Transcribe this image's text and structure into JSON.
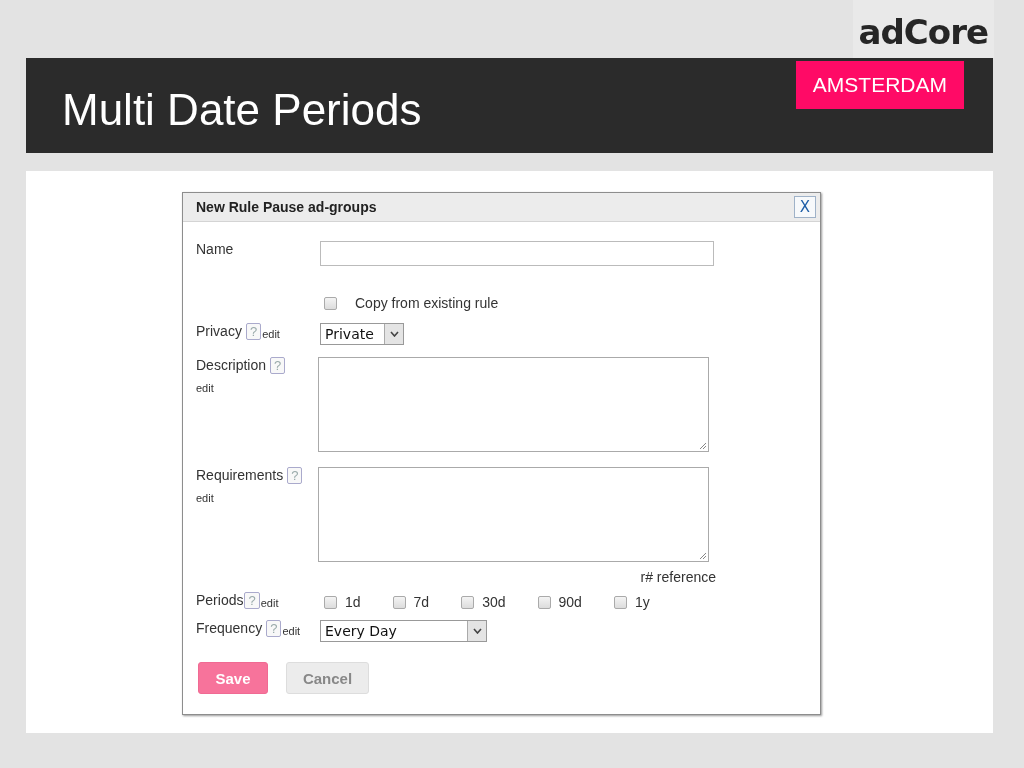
{
  "logo": "adCore",
  "slide": {
    "title": "Multi Date Periods",
    "location": "AMSTERDAM"
  },
  "dialog": {
    "title": "New Rule Pause ad-groups",
    "close": "X",
    "name_field": {
      "label": "Name"
    },
    "copy_option": {
      "label": "Copy from existing rule",
      "checked": false
    },
    "privacy": {
      "label": "Privacy",
      "help": "?",
      "edit": "edit",
      "value": "Private"
    },
    "description": {
      "label": "Description",
      "help": "?",
      "edit": "edit"
    },
    "requirements": {
      "label": "Requirements",
      "help": "?",
      "edit": "edit"
    },
    "reference": "r# reference",
    "periods": {
      "label": "Periods",
      "help": "?",
      "edit": "edit",
      "options": [
        {
          "label": "1d",
          "checked": false
        },
        {
          "label": "7d",
          "checked": false
        },
        {
          "label": "30d",
          "checked": false
        },
        {
          "label": "90d",
          "checked": false
        },
        {
          "label": "1y",
          "checked": false
        }
      ]
    },
    "frequency": {
      "label": "Frequency",
      "help": "?",
      "edit": "edit",
      "value": "Every Day"
    },
    "buttons": [
      {
        "label": "Save",
        "kind": "primary"
      },
      {
        "label": "Cancel",
        "kind": "secondary"
      }
    ]
  }
}
